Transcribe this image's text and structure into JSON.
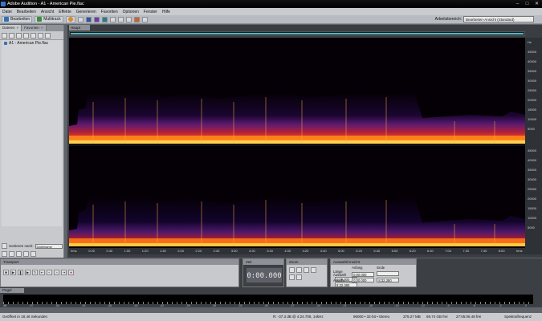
{
  "title_bar": {
    "title": "Adobe Audition - A1 - American Pie.flac"
  },
  "menu": [
    "Datei",
    "Bearbeiten",
    "Ansicht",
    "Effekte",
    "Generieren",
    "Favoriten",
    "Optionen",
    "Fenster",
    "Hilfe"
  ],
  "toolbar": {
    "edit_label": "Bearbeiten",
    "multitrack_label": "Multitrack",
    "workspace_label": "Arbeitsbereich:",
    "workspace_value": "Bearbeiten-Ansicht (Standard)"
  },
  "files_panel": {
    "tabs": [
      "Dateien",
      "Favoriten"
    ],
    "items": [
      "A1 - American Pie.flac"
    ],
    "sort_label": "Sortieren nach:",
    "sort_value": "Dateiname"
  },
  "editor": {
    "tab_label": "Haupt",
    "freq_labels": [
      "Hz",
      "45000",
      "40000",
      "35000",
      "30000",
      "25000",
      "20000",
      "15000",
      "10000",
      "5000",
      "",
      "45000",
      "40000",
      "35000",
      "30000",
      "25000",
      "20000",
      "15000",
      "10000",
      "5000",
      ""
    ],
    "time_labels": [
      "hms",
      "0:20",
      "0:40",
      "1:00",
      "1:20",
      "1:40",
      "2:00",
      "2:20",
      "2:40",
      "3:00",
      "3:20",
      "3:40",
      "4:00",
      "4:20",
      "4:40",
      "5:00",
      "5:20",
      "5:40",
      "6:00",
      "6:20",
      "6:40",
      "7:00",
      "7:20",
      "7:40",
      "8:00",
      "hms"
    ]
  },
  "transport": {
    "title": "Transport"
  },
  "time_panel": {
    "title": "Zeit",
    "value": "0:00.000"
  },
  "zoom_panel": {
    "title": "Zoom"
  },
  "selection_panel": {
    "title": "Auswahl/Ansicht",
    "col_headers": [
      "Anfang",
      "Ende",
      "Länge"
    ],
    "rows": [
      {
        "label": "Auswahl",
        "values": [
          "0:00.000",
          "",
          "0:00.000"
        ]
      },
      {
        "label": "Ansicht",
        "values": [
          "0:00.000",
          "8:32.380",
          "8:32.380"
        ]
      }
    ]
  },
  "level_panel": {
    "title": "Pegel",
    "scale": [
      "dB",
      "-57",
      "-54",
      "-51",
      "-48",
      "-45",
      "-42",
      "-39",
      "-36",
      "-33",
      "-30",
      "-27",
      "-24",
      "-21",
      "-18",
      "-15",
      "-12",
      "-9",
      "-6",
      "-3",
      "0"
    ]
  },
  "status_bar": {
    "left": "Geöffnet in 18.46 Sekunden",
    "cursor": "R: -37.3 dB @ 4:24.705, 14kHz",
    "format": "96000 • 32-bit • Stereo",
    "size": "375.27 MB",
    "free": "69.74 GB frei",
    "free_time": "27:05:06.48 frei",
    "mode": "Spektralfrequenz"
  }
}
